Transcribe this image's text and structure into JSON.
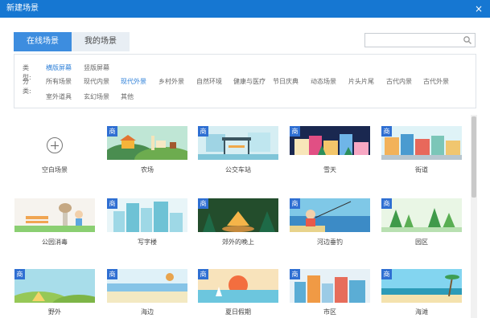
{
  "window": {
    "title": "新建场景",
    "close_symbol": "×"
  },
  "tabs": [
    {
      "label": "在线场景",
      "active": true
    },
    {
      "label": "我的场景",
      "active": false
    }
  ],
  "search": {
    "placeholder": "",
    "icon": "search-icon"
  },
  "filters": {
    "type_label": "类型:",
    "type_options": [
      {
        "label": "横版屏幕",
        "selected": true
      },
      {
        "label": "竖版屏幕",
        "selected": false
      }
    ],
    "category_label": "分类:",
    "category_options": [
      {
        "label": "所有场景",
        "selected": false
      },
      {
        "label": "现代内景",
        "selected": false
      },
      {
        "label": "现代外景",
        "selected": true
      },
      {
        "label": "乡村外景",
        "selected": false
      },
      {
        "label": "自然环境",
        "selected": false
      },
      {
        "label": "健康与医疗",
        "selected": false
      },
      {
        "label": "节日庆典",
        "selected": false
      },
      {
        "label": "动态场景",
        "selected": false
      },
      {
        "label": "片头片尾",
        "selected": false
      },
      {
        "label": "古代内景",
        "selected": false
      },
      {
        "label": "古代外景",
        "selected": false
      },
      {
        "label": "室外道具",
        "selected": false
      },
      {
        "label": "玄幻场景",
        "selected": false
      },
      {
        "label": "其他",
        "selected": false
      }
    ]
  },
  "badge_text": "商",
  "scenes": [
    {
      "label": "空白场景",
      "premium": false,
      "type": "blank"
    },
    {
      "label": "农场",
      "premium": true,
      "colors": [
        "#bfe6d5",
        "#f5b43a",
        "#4a8d50"
      ]
    },
    {
      "label": "公交车站",
      "premium": true,
      "colors": [
        "#d6eef3",
        "#3c5560",
        "#80c5d8"
      ]
    },
    {
      "label": "雪天",
      "premium": true,
      "colors": [
        "#1a2850",
        "#f8e6b9",
        "#e14f84"
      ]
    },
    {
      "label": "街道",
      "premium": true,
      "colors": [
        "#dff3f7",
        "#f2b25a",
        "#4a9bd0"
      ]
    },
    {
      "label": "公园消毒",
      "premium": false,
      "colors": [
        "#f6f3ee",
        "#f0a552",
        "#8bcf72"
      ]
    },
    {
      "label": "写字楼",
      "premium": true,
      "colors": [
        "#e8f5f8",
        "#6ec2d5",
        "#9ed8e6"
      ]
    },
    {
      "label": "郊外的晚上",
      "premium": true,
      "colors": [
        "#234d2c",
        "#1e6a47",
        "#f5b449"
      ]
    },
    {
      "label": "河边垂钓",
      "premium": true,
      "colors": [
        "#7fc8e7",
        "#3c8bc6",
        "#e8d38c"
      ]
    },
    {
      "label": "园区",
      "premium": true,
      "colors": [
        "#e9f6e5",
        "#3f9a4a",
        "#b8e0b1"
      ]
    },
    {
      "label": "野外",
      "premium": true,
      "colors": [
        "#a8ddea",
        "#96c857",
        "#f7d36a"
      ]
    },
    {
      "label": "海边",
      "premium": true,
      "colors": [
        "#f3e9c2",
        "#86c4e7",
        "#e8a44e"
      ]
    },
    {
      "label": "夏日假期",
      "premium": true,
      "colors": [
        "#f8e3bb",
        "#f36e3f",
        "#6cc6de"
      ]
    },
    {
      "label": "市区",
      "premium": true,
      "colors": [
        "#e7f1f7",
        "#f09a45",
        "#5badd5"
      ]
    },
    {
      "label": "海滩",
      "premium": true,
      "colors": [
        "#83d5f0",
        "#f4e2ae",
        "#2c9bb8"
      ]
    }
  ]
}
